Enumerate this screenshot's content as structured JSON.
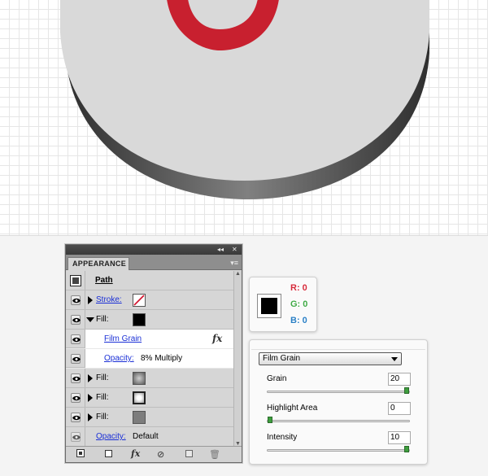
{
  "panel": {
    "tab_label": "APPEARANCE",
    "collapse_icon": "double-chevron-icon",
    "close_label": "✕",
    "menu_icon": "panel-menu-icon",
    "header_label": "Path",
    "rows": [
      {
        "label": "Stroke:"
      },
      {
        "label": "Fill:"
      },
      {
        "effect_label": "Film Grain",
        "fx_label": "fx"
      },
      {
        "opacity_label": "Opacity:",
        "opacity_value": "8% Multiply"
      },
      {
        "label": "Fill:"
      },
      {
        "label": "Fill:"
      },
      {
        "label": "Fill:"
      },
      {
        "opacity_label": "Opacity:",
        "opacity_value": "Default"
      }
    ],
    "bottom_fx": "fx"
  },
  "color_readout": {
    "r": "R: 0",
    "g": "G: 0",
    "b": "B: 0",
    "r_color": "#d42a3a",
    "g_color": "#3ea844",
    "b_color": "#2a7fc4"
  },
  "film_grain": {
    "filter": "Film Grain",
    "params": [
      {
        "label": "Grain",
        "value": "20",
        "level": 1.0
      },
      {
        "label": "Highlight Area",
        "value": "0",
        "level": 0.0
      },
      {
        "label": "Intensity",
        "value": "10",
        "level": 1.0
      }
    ]
  },
  "colors": {
    "red_ring": "#c8202f",
    "disk_top": "#dadada",
    "disk_side": "#5a5a5a"
  }
}
